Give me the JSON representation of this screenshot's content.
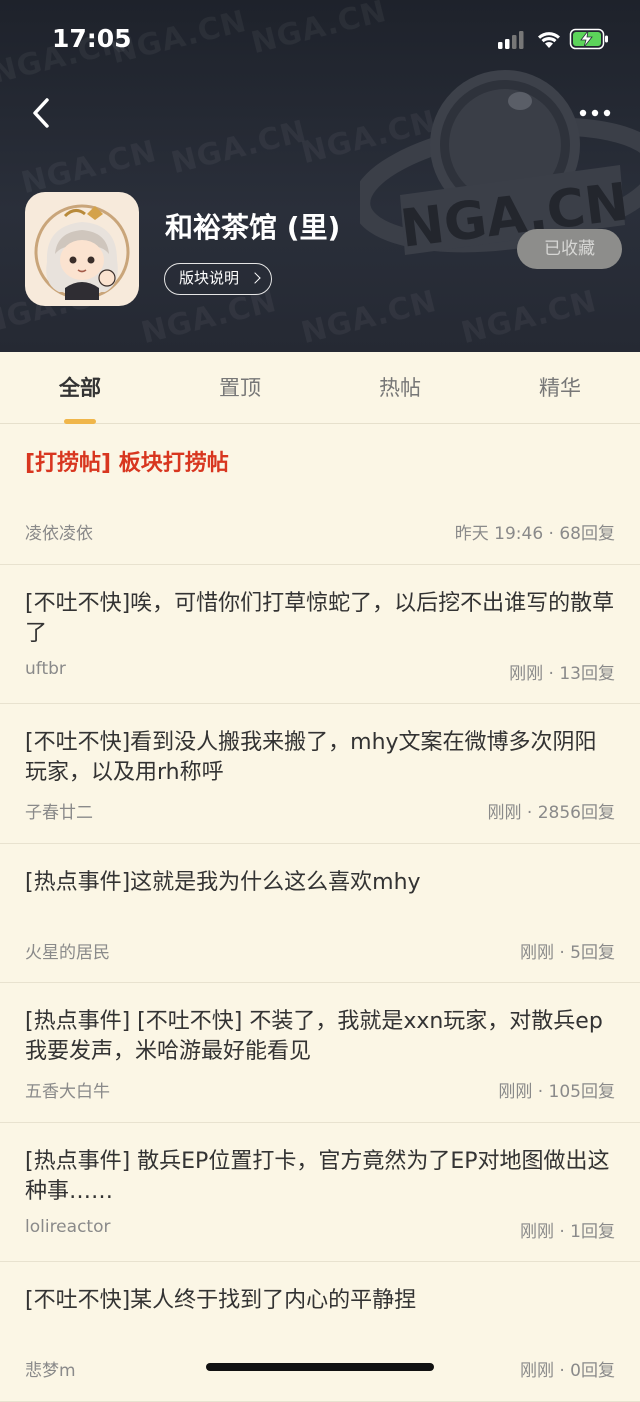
{
  "status_bar": {
    "time": "17:05"
  },
  "header": {
    "watermark": "NGA.CN",
    "forum_title": "和裕茶馆 (里)",
    "description_button": "版块说明",
    "favorite_button": "已收藏"
  },
  "tabs": [
    {
      "label": "全部",
      "active": true
    },
    {
      "label": "置顶",
      "active": false
    },
    {
      "label": "热帖",
      "active": false
    },
    {
      "label": "精华",
      "active": false
    }
  ],
  "posts": [
    {
      "title": "[打捞帖] 板块打捞帖",
      "author": "凌依凌依",
      "time": "昨天 19:46",
      "replies": "68回复",
      "pinned": true
    },
    {
      "title": "[不吐不快]唉，可惜你们打草惊蛇了，以后挖不出谁写的散草了",
      "author": "uftbr",
      "time": "刚刚",
      "replies": "13回复"
    },
    {
      "title": "[不吐不快]看到没人搬我来搬了，mhy文案在微博多次阴阳玩家，以及用rh称呼",
      "author": "子春廿二",
      "time": "刚刚",
      "replies": "2856回复"
    },
    {
      "title": "[热点事件]这就是我为什么这么喜欢mhy",
      "author": "火星的居民",
      "time": "刚刚",
      "replies": "5回复"
    },
    {
      "title": "[热点事件] [不吐不快] 不装了，我就是xxn玩家，对散兵ep我要发声，米哈游最好能看见",
      "author": "五香大白牛",
      "time": "刚刚",
      "replies": "105回复"
    },
    {
      "title": "[热点事件] 散兵EP位置打卡，官方竟然为了EP对地图做出这种事……",
      "author": "lolireactor",
      "time": "刚刚",
      "replies": "1回复"
    },
    {
      "title": "[不吐不快]某人终于找到了内心的平静捏",
      "author": "悲梦m",
      "time": "刚刚",
      "replies": "0回复"
    }
  ],
  "colors": {
    "accent": "#f0b64a",
    "pinned_red": "#d8361f",
    "background": "#fbf6e5",
    "header_dark": "#252933"
  },
  "icons": [
    "back-arrow-icon",
    "more-dots-icon",
    "signal-icon",
    "wifi-icon",
    "battery-charging-icon",
    "chevron-right-icon"
  ]
}
